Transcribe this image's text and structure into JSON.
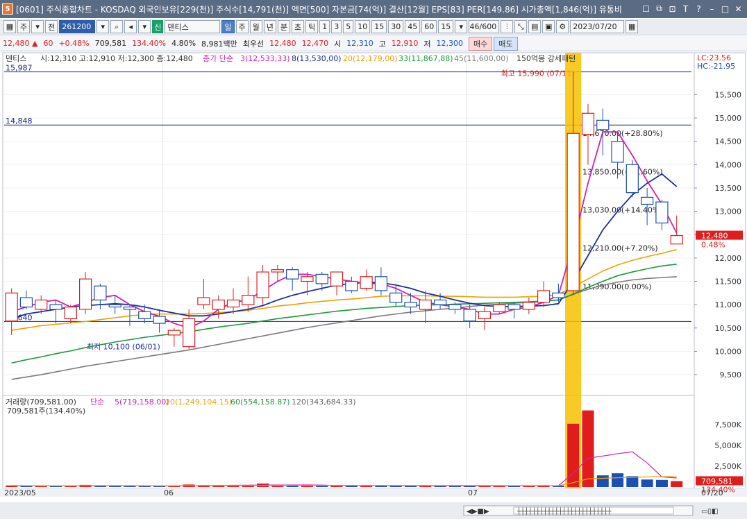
{
  "window": {
    "title": "[0601] 주식종합차트 - KOSDAQ 외국인보유[229(천)] 주식수[14,791(천)] 액면[500] 자본금[74(억)] 결산[12월] EPS[83] PER[149.86] 시가총액[1,846(억)] 유통비",
    "app_badge": "5",
    "icons": [
      "window-list-icon",
      "restore-icon",
      "lock-icon",
      "text-icon",
      "help-icon",
      "minimize-icon",
      "maximize-icon",
      "close-icon"
    ]
  },
  "toolbar": {
    "mode1": "주",
    "mode2": "전",
    "stock_code": "261200",
    "tag": "신",
    "stock_name": "덴티스",
    "periods": [
      "일",
      "주",
      "월",
      "년",
      "분",
      "초",
      "틱"
    ],
    "selected_period": "일",
    "intervals": [
      "1",
      "3",
      "5",
      "10",
      "15",
      "30",
      "45",
      "60"
    ],
    "interval_value": "15",
    "count": "46/600",
    "date": "2023/07/20"
  },
  "quote": {
    "price": "12,480",
    "change": "60",
    "change_pct": "+0.48%",
    "volume": "709,581",
    "volume_ratio": "134.40%",
    "turnover": "4.80%",
    "amount": "8,981백만",
    "priority_label": "최우선",
    "ask": "12,480",
    "bid": "12,470",
    "open_label": "시",
    "open": "12,310",
    "high_label": "고",
    "high": "12,910",
    "low_label": "저",
    "low": "12,300",
    "buy_label": "매수",
    "sell_label": "매도"
  },
  "price_legend": {
    "name": "덴티스",
    "ohlc": "시:12,310 고:12,910 저:12,300 종:12,480",
    "ma_label": "종가 단순",
    "ma3": "3(12,533,33)",
    "ma8": "8(13,530,00)",
    "ma20": "20(12,179,00)",
    "ma33": "33(11,867,88)",
    "ma45": "45(11,600,00)",
    "pattern": "150억봉 강세패턴"
  },
  "right_labels": {
    "lc": "LC:23.56",
    "hc": "HC:-21.95",
    "last_price": "12,480",
    "last_pct": "0.48%",
    "last_volume": "709,581",
    "last_volume_pct": "134.40%"
  },
  "annotations": {
    "high": "최고 15,990 (07/11)",
    "low": "최저 10,100 (06/01)",
    "line_top": "15,987",
    "line_mid": "14,848",
    "line_low": "10,640",
    "fib": [
      "14,670.00(+28.80%)",
      "13,850.00(+21.60%)",
      "13,030.00(+14.40%)",
      "12,210.00(+7.20%)",
      "11,390.00(0.00%)"
    ]
  },
  "volume_legend": {
    "volume": "거래량(709,581.00)",
    "ma_label": "단순",
    "ma5": "5(719,158.00)",
    "ma20": "20(1,249,104.15)",
    "ma60": "60(554,158.87)",
    "ma120": "120(343,684.33)",
    "current": "709,581주(134.40%)"
  },
  "x_labels": [
    "2023/05",
    "06",
    "07",
    "07/20"
  ],
  "colors": {
    "up": "#e01c1c",
    "down": "#1a4fb5",
    "ma3": "#d21fb0",
    "ma8": "#1a2fa0",
    "ma20": "#f0a000",
    "ma33": "#1a9a3a",
    "ma45": "#7a7a7a",
    "highlight": "#f7c100"
  },
  "chart_data": {
    "type": "candlestick",
    "y_axis": [
      9500,
      10000,
      10500,
      11000,
      11500,
      12000,
      12500,
      13000,
      13500,
      14000,
      14500,
      15000,
      15500
    ],
    "vol_axis": [
      "2,500K",
      "5,000K",
      "7,500K"
    ],
    "ylim": [
      9100,
      16100
    ],
    "vol_max": 9000000,
    "candles": [
      {
        "o": 10650,
        "h": 11350,
        "l": 10350,
        "c": 11250,
        "v": 180000
      },
      {
        "o": 11150,
        "h": 11300,
        "l": 10900,
        "c": 10950,
        "v": 140000
      },
      {
        "o": 10900,
        "h": 11200,
        "l": 10800,
        "c": 11100,
        "v": 120000
      },
      {
        "o": 11000,
        "h": 11100,
        "l": 10600,
        "c": 10900,
        "v": 110000
      },
      {
        "o": 10700,
        "h": 11000,
        "l": 10600,
        "c": 10950,
        "v": 150000
      },
      {
        "o": 10900,
        "h": 11700,
        "l": 10800,
        "c": 11550,
        "v": 260000
      },
      {
        "o": 11400,
        "h": 11450,
        "l": 10900,
        "c": 11100,
        "v": 190000
      },
      {
        "o": 11000,
        "h": 11200,
        "l": 10800,
        "c": 10950,
        "v": 130000
      },
      {
        "o": 10950,
        "h": 11000,
        "l": 10550,
        "c": 10900,
        "v": 120000
      },
      {
        "o": 10850,
        "h": 11000,
        "l": 10600,
        "c": 10700,
        "v": 110000
      },
      {
        "o": 10750,
        "h": 10900,
        "l": 10400,
        "c": 10600,
        "v": 100000
      },
      {
        "o": 10350,
        "h": 10500,
        "l": 10100,
        "c": 10450,
        "v": 170000
      },
      {
        "o": 10100,
        "h": 10900,
        "l": 10050,
        "c": 10700,
        "v": 300000
      },
      {
        "o": 11000,
        "h": 11550,
        "l": 10900,
        "c": 11150,
        "v": 220000
      },
      {
        "o": 10900,
        "h": 11200,
        "l": 10700,
        "c": 11100,
        "v": 180000
      },
      {
        "o": 10950,
        "h": 11350,
        "l": 10800,
        "c": 11100,
        "v": 160000
      },
      {
        "o": 11000,
        "h": 11600,
        "l": 10850,
        "c": 11200,
        "v": 250000
      },
      {
        "o": 11150,
        "h": 11850,
        "l": 11000,
        "c": 11700,
        "v": 420000
      },
      {
        "o": 11700,
        "h": 11850,
        "l": 11500,
        "c": 11750,
        "v": 210000
      },
      {
        "o": 11750,
        "h": 11800,
        "l": 11300,
        "c": 11550,
        "v": 190000
      },
      {
        "o": 11500,
        "h": 11700,
        "l": 11200,
        "c": 11600,
        "v": 170000
      },
      {
        "o": 11650,
        "h": 11700,
        "l": 11300,
        "c": 11450,
        "v": 160000
      },
      {
        "o": 11400,
        "h": 11600,
        "l": 11200,
        "c": 11700,
        "v": 200000
      },
      {
        "o": 11500,
        "h": 11600,
        "l": 11250,
        "c": 11300,
        "v": 150000
      },
      {
        "o": 11350,
        "h": 11750,
        "l": 11300,
        "c": 11600,
        "v": 180000
      },
      {
        "o": 11600,
        "h": 11800,
        "l": 11200,
        "c": 11300,
        "v": 170000
      },
      {
        "o": 11250,
        "h": 11400,
        "l": 10950,
        "c": 11050,
        "v": 140000
      },
      {
        "o": 11050,
        "h": 11250,
        "l": 10800,
        "c": 10950,
        "v": 130000
      },
      {
        "o": 10900,
        "h": 11300,
        "l": 10600,
        "c": 11100,
        "v": 160000
      },
      {
        "o": 11100,
        "h": 11250,
        "l": 10900,
        "c": 11000,
        "v": 120000
      },
      {
        "o": 11000,
        "h": 11050,
        "l": 10800,
        "c": 10900,
        "v": 110000
      },
      {
        "o": 10900,
        "h": 11000,
        "l": 10500,
        "c": 10650,
        "v": 140000
      },
      {
        "o": 10700,
        "h": 10950,
        "l": 10450,
        "c": 10850,
        "v": 150000
      },
      {
        "o": 10850,
        "h": 11050,
        "l": 10800,
        "c": 11000,
        "v": 130000
      },
      {
        "o": 11000,
        "h": 11050,
        "l": 10700,
        "c": 10900,
        "v": 120000
      },
      {
        "o": 10900,
        "h": 11150,
        "l": 10800,
        "c": 11050,
        "v": 140000
      },
      {
        "o": 11050,
        "h": 11500,
        "l": 10950,
        "c": 11300,
        "v": 220000
      },
      {
        "o": 11250,
        "h": 11450,
        "l": 11050,
        "c": 11150,
        "v": 170000
      },
      {
        "o": 11300,
        "h": 15990,
        "l": 11200,
        "c": 14670,
        "v": 7600000
      },
      {
        "o": 14650,
        "h": 15300,
        "l": 14000,
        "c": 15100,
        "v": 9200000
      },
      {
        "o": 14950,
        "h": 15200,
        "l": 14200,
        "c": 14750,
        "v": 1400000
      },
      {
        "o": 14500,
        "h": 14700,
        "l": 13700,
        "c": 14050,
        "v": 1650000
      },
      {
        "o": 14000,
        "h": 14100,
        "l": 13300,
        "c": 13400,
        "v": 1300000
      },
      {
        "o": 13300,
        "h": 13500,
        "l": 12700,
        "c": 13150,
        "v": 900000
      },
      {
        "o": 13200,
        "h": 13250,
        "l": 12600,
        "c": 12750,
        "v": 850000
      },
      {
        "o": 12300,
        "h": 12910,
        "l": 12300,
        "c": 12480,
        "v": 709581
      }
    ],
    "ma3": [
      10850,
      10950,
      11050,
      11100,
      10950,
      11050,
      11150,
      11200,
      11000,
      10850,
      10750,
      10600,
      10500,
      10650,
      10900,
      11050,
      11100,
      11300,
      11500,
      11650,
      11650,
      11600,
      11550,
      11500,
      11450,
      11450,
      11350,
      11200,
      11050,
      11000,
      10950,
      10900,
      10800,
      10800,
      10900,
      10950,
      11050,
      11200,
      12300,
      13600,
      14700,
      14700,
      14200,
      13650,
      13150,
      12533
    ],
    "ma8": [
      10700,
      10800,
      10850,
      10900,
      10950,
      10980,
      11000,
      11020,
      11000,
      10950,
      10880,
      10820,
      10760,
      10760,
      10800,
      10850,
      10900,
      10980,
      11100,
      11200,
      11280,
      11350,
      11420,
      11450,
      11480,
      11470,
      11420,
      11350,
      11250,
      11180,
      11100,
      11030,
      10980,
      10960,
      10960,
      10970,
      10980,
      11020,
      11500,
      12050,
      12600,
      13000,
      13350,
      13600,
      13800,
      13530
    ],
    "ma20": [
      10450,
      10500,
      10550,
      10580,
      10610,
      10640,
      10680,
      10720,
      10760,
      10790,
      10800,
      10800,
      10800,
      10810,
      10830,
      10850,
      10880,
      10920,
      10970,
      11000,
      11040,
      11070,
      11100,
      11120,
      11150,
      11180,
      11190,
      11190,
      11190,
      11180,
      11180,
      11170,
      11160,
      11160,
      11160,
      11170,
      11180,
      11220,
      11380,
      11550,
      11720,
      11850,
      11950,
      12030,
      12100,
      12179
    ],
    "ma33": [
      9750,
      9820,
      9880,
      9950,
      10010,
      10080,
      10140,
      10200,
      10250,
      10300,
      10340,
      10380,
      10420,
      10470,
      10520,
      10560,
      10600,
      10650,
      10700,
      10740,
      10780,
      10820,
      10860,
      10890,
      10920,
      10940,
      10960,
      10980,
      10990,
      11000,
      11010,
      11020,
      11030,
      11040,
      11050,
      11060,
      11080,
      11100,
      11230,
      11370,
      11500,
      11620,
      11700,
      11770,
      11830,
      11867
    ],
    "ma45": [
      9400,
      9450,
      9500,
      9560,
      9620,
      9680,
      9730,
      9780,
      9830,
      9880,
      9930,
      9980,
      10030,
      10090,
      10150,
      10210,
      10270,
      10330,
      10390,
      10450,
      10510,
      10560,
      10610,
      10660,
      10710,
      10760,
      10800,
      10840,
      10870,
      10900,
      10930,
      10960,
      10990,
      11010,
      11030,
      11050,
      11070,
      11100,
      11220,
      11330,
      11420,
      11480,
      11530,
      11560,
      11580,
      11600
    ],
    "highlight_index": 38
  }
}
